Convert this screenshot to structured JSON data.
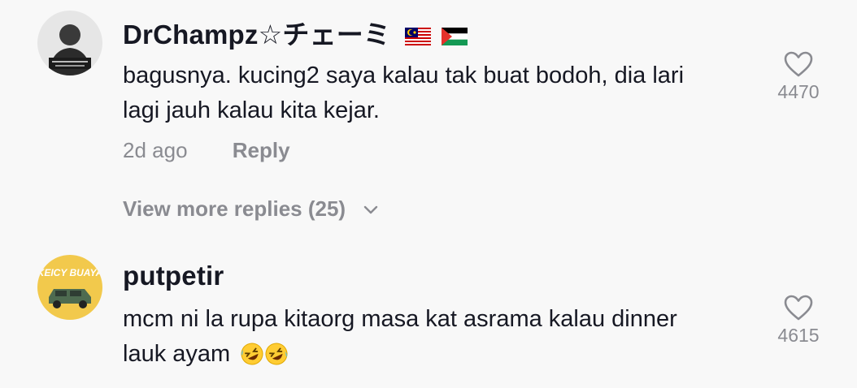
{
  "comments": [
    {
      "username": "DrChampz☆チェーミ",
      "flags": [
        "malaysia-flag-icon",
        "palestine-flag-icon"
      ],
      "avatar_icon": "user-avatar-drchampz",
      "text_lines": [
        "bagusnya. kucing2 saya kalau tak buat bodoh, dia lari",
        "lagi jauh kalau kita kejar."
      ],
      "time": "2d ago",
      "reply_label": "Reply",
      "view_more": "View more replies (25)",
      "likes": "4470"
    },
    {
      "username": "putpetir",
      "avatar_icon": "user-avatar-putpetir",
      "avatar_text": "KEICY BUAYA",
      "text_lines": [
        "mcm ni la rupa kitaorg masa kat asrama kalau dinner",
        "lauk ayam"
      ],
      "text_emojis": [
        "rolling-on-floor-laughing-emoji",
        "rolling-on-floor-laughing-emoji"
      ],
      "likes": "4615"
    }
  ],
  "colors": {
    "background": "#f8f8f8",
    "text": "#161823",
    "secondary": "#8a8b91",
    "avatar2_bg": "#f2c94c"
  }
}
